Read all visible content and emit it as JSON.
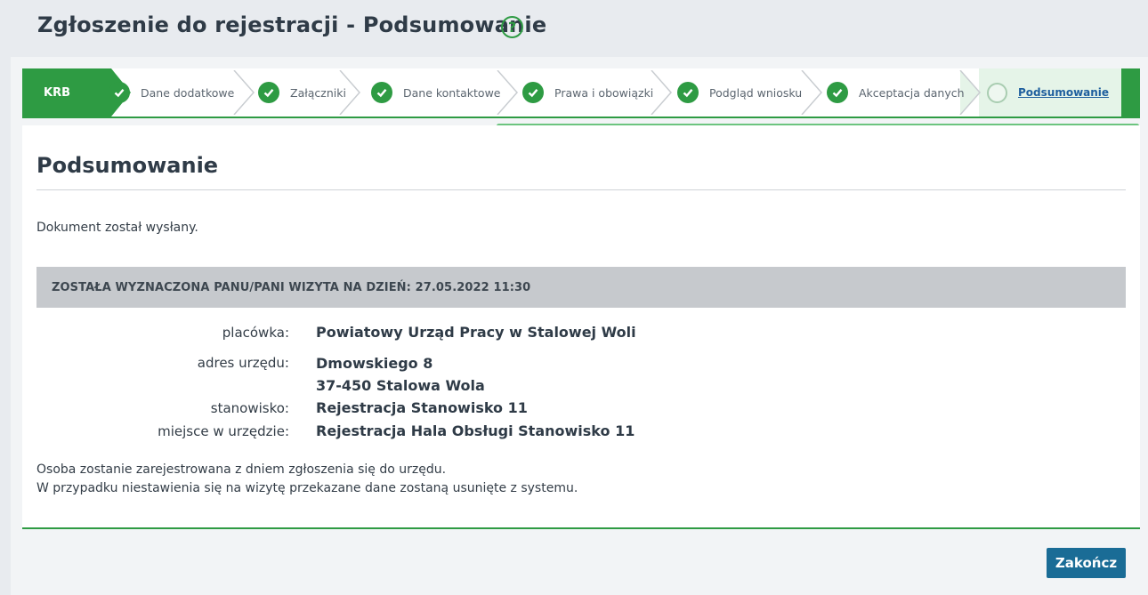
{
  "page": {
    "title": "Zgłoszenie do rejestracji - Podsumowanie",
    "help_icon": "question-circle-icon"
  },
  "stepper": {
    "first": "KRB",
    "steps": [
      {
        "label": "Dane dodatkowe",
        "state": "done"
      },
      {
        "label": "Załączniki",
        "state": "done"
      },
      {
        "label": "Dane kontaktowe",
        "state": "done"
      },
      {
        "label": "Prawa i obowiązki",
        "state": "done"
      },
      {
        "label": "Podgląd wniosku",
        "state": "done"
      },
      {
        "label": "Akceptacja danych",
        "state": "done"
      },
      {
        "label": "Podsumowanie",
        "state": "active"
      }
    ],
    "colors": {
      "accent": "#2e9b43",
      "active_bg": "#e5f4e8",
      "progress": "#6cc47f"
    }
  },
  "summary": {
    "heading": "Podsumowanie",
    "sent_message": "Dokument został wysłany.",
    "visit_banner": "ZOSTAŁA WYZNACZONA PANU/PANI WIZYTA NA DZIEŃ: 27.05.2022 11:30",
    "details": {
      "office_label": "placówka:",
      "office_value": "Powiatowy Urząd Pracy w Stalowej Woli",
      "address_label": "adres urzędu:",
      "address_line1": "Dmowskiego 8",
      "address_line2": "37-450 Stalowa Wola",
      "desk_label": "stanowisko:",
      "desk_value": "Rejestracja Stanowisko 11",
      "place_label": "miejsce w urzędzie:",
      "place_value": "Rejestracja Hala Obsługi Stanowisko 11"
    },
    "note_line1": "Osoba zostanie zarejestrowana z dniem zgłoszenia się do urzędu.",
    "note_line2": "W przypadku niestawienia się na wizytę przekazane dane zostaną usunięte z systemu."
  },
  "actions": {
    "finish_label": "Zakończ",
    "finish_color": "#1a6c96"
  }
}
